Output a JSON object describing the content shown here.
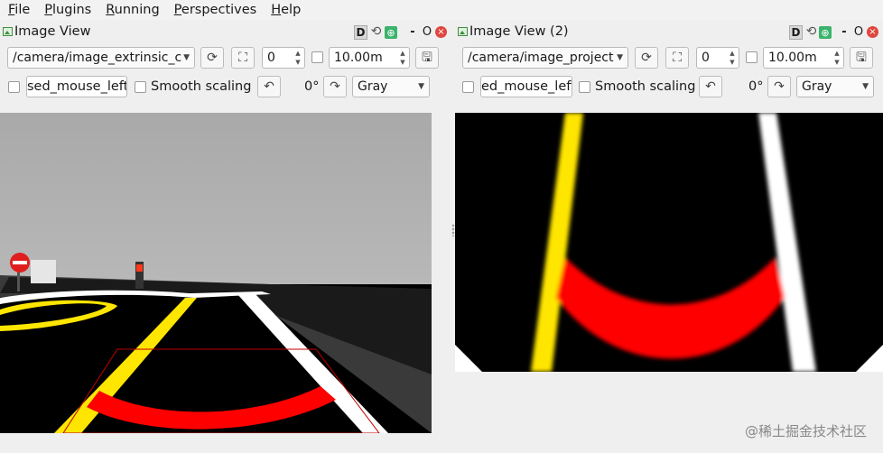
{
  "menubar": {
    "items": [
      {
        "first": "F",
        "rest": "ile"
      },
      {
        "first": "P",
        "rest": "lugins"
      },
      {
        "first": "R",
        "rest": "unning"
      },
      {
        "first": "P",
        "rest": "erspectives"
      },
      {
        "first": "H",
        "rest": "elp"
      }
    ]
  },
  "left_panel": {
    "title": "Image View",
    "topic": "/camera/image_extrinsic_c",
    "spin_value": "0",
    "distance": "10.00m",
    "mouse_topic": "sed_mouse_left",
    "smooth_scaling_label": "Smooth scaling",
    "rotation": "0°",
    "colormap": "Gray"
  },
  "right_panel": {
    "title": "Image View (2)",
    "topic": "/camera/image_project",
    "spin_value": "0",
    "distance": "10.00m",
    "mouse_topic": "ed_mouse_left",
    "smooth_scaling_label": "Smooth scaling",
    "rotation": "0°",
    "colormap": "Gray"
  },
  "title_buttons": {
    "d": "D",
    "min": "-",
    "o": "O",
    "close": "×"
  },
  "icons": {
    "refresh": "refresh-icon",
    "fit": "zoom-fit-icon",
    "save": "save-icon",
    "rotate_left": "rotate-left-icon",
    "rotate_right": "rotate-right-icon",
    "image": "image-icon"
  },
  "colors": {
    "lane_yellow": "#ffe600",
    "lane_white": "#ffffff",
    "arc_red": "#ff0000",
    "road_black": "#000000",
    "sky_gray": "#b4b4b4"
  },
  "watermark": "@稀土掘金技术社区"
}
